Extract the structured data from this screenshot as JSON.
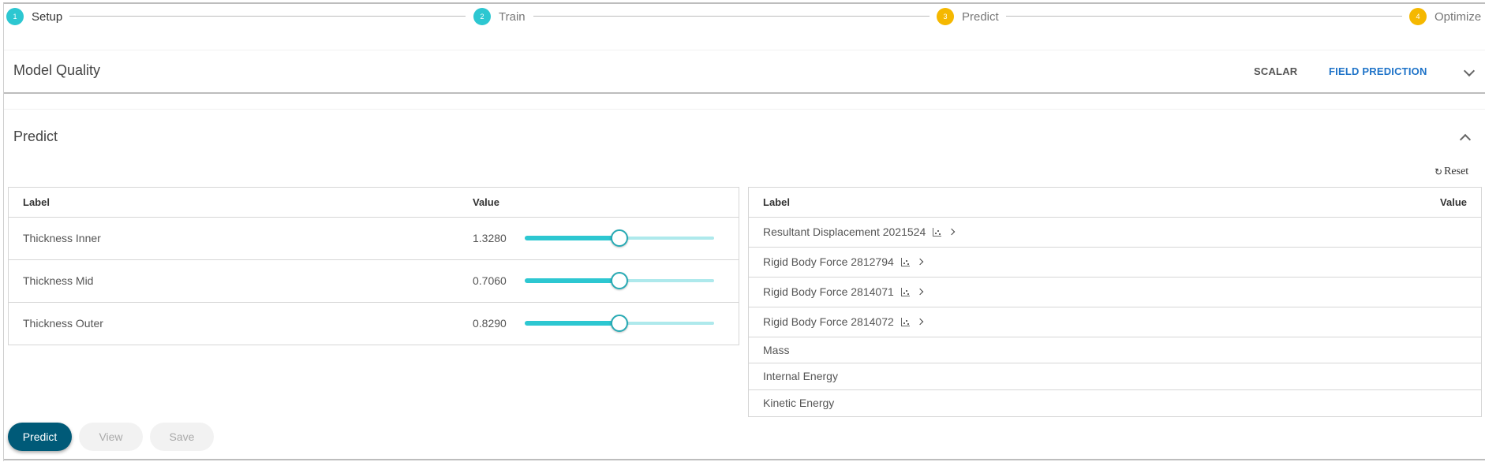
{
  "colors": {
    "step_done": "#2dc7d1",
    "step_pending": "#f5b800",
    "accent_blue": "#1e73c8",
    "primary_button": "#005a78",
    "slider_track": "#2dc7d1",
    "slider_rail": "#aee9ec"
  },
  "stepper": {
    "steps": [
      {
        "number": "1",
        "label": "Setup",
        "state": "active"
      },
      {
        "number": "2",
        "label": "Train",
        "state": "done"
      },
      {
        "number": "3",
        "label": "Predict",
        "state": "pending"
      },
      {
        "number": "4",
        "label": "Optimize",
        "state": "pending"
      }
    ]
  },
  "model_quality": {
    "title": "Model Quality",
    "tabs": [
      {
        "label": "SCALAR",
        "selected": false
      },
      {
        "label": "FIELD PREDICTION",
        "selected": true
      }
    ],
    "expand_icon": "chevron-down-icon"
  },
  "predict": {
    "title": "Predict",
    "collapse_icon": "chevron-up-icon",
    "reset_label": "Reset",
    "inputs_table": {
      "headers": {
        "label": "Label",
        "value": "Value"
      },
      "rows": [
        {
          "label": "Thickness Inner",
          "value": "1.3280",
          "slider_fraction": 0.5
        },
        {
          "label": "Thickness Mid",
          "value": "0.7060",
          "slider_fraction": 0.5
        },
        {
          "label": "Thickness Outer",
          "value": "0.8290",
          "slider_fraction": 0.5
        }
      ]
    },
    "outputs_table": {
      "headers": {
        "label": "Label",
        "value": "Value"
      },
      "rows": [
        {
          "label": "Resultant Displacement 2021524",
          "has_plot": true,
          "value": ""
        },
        {
          "label": "Rigid Body Force 2812794",
          "has_plot": true,
          "value": ""
        },
        {
          "label": "Rigid Body Force 2814071",
          "has_plot": true,
          "value": ""
        },
        {
          "label": "Rigid Body Force 2814072",
          "has_plot": true,
          "value": ""
        },
        {
          "label": "Mass",
          "has_plot": false,
          "value": ""
        },
        {
          "label": "Internal Energy",
          "has_plot": false,
          "value": ""
        },
        {
          "label": "Kinetic Energy",
          "has_plot": false,
          "value": ""
        }
      ]
    },
    "buttons": {
      "predict": "Predict",
      "view": "View",
      "save": "Save"
    }
  }
}
